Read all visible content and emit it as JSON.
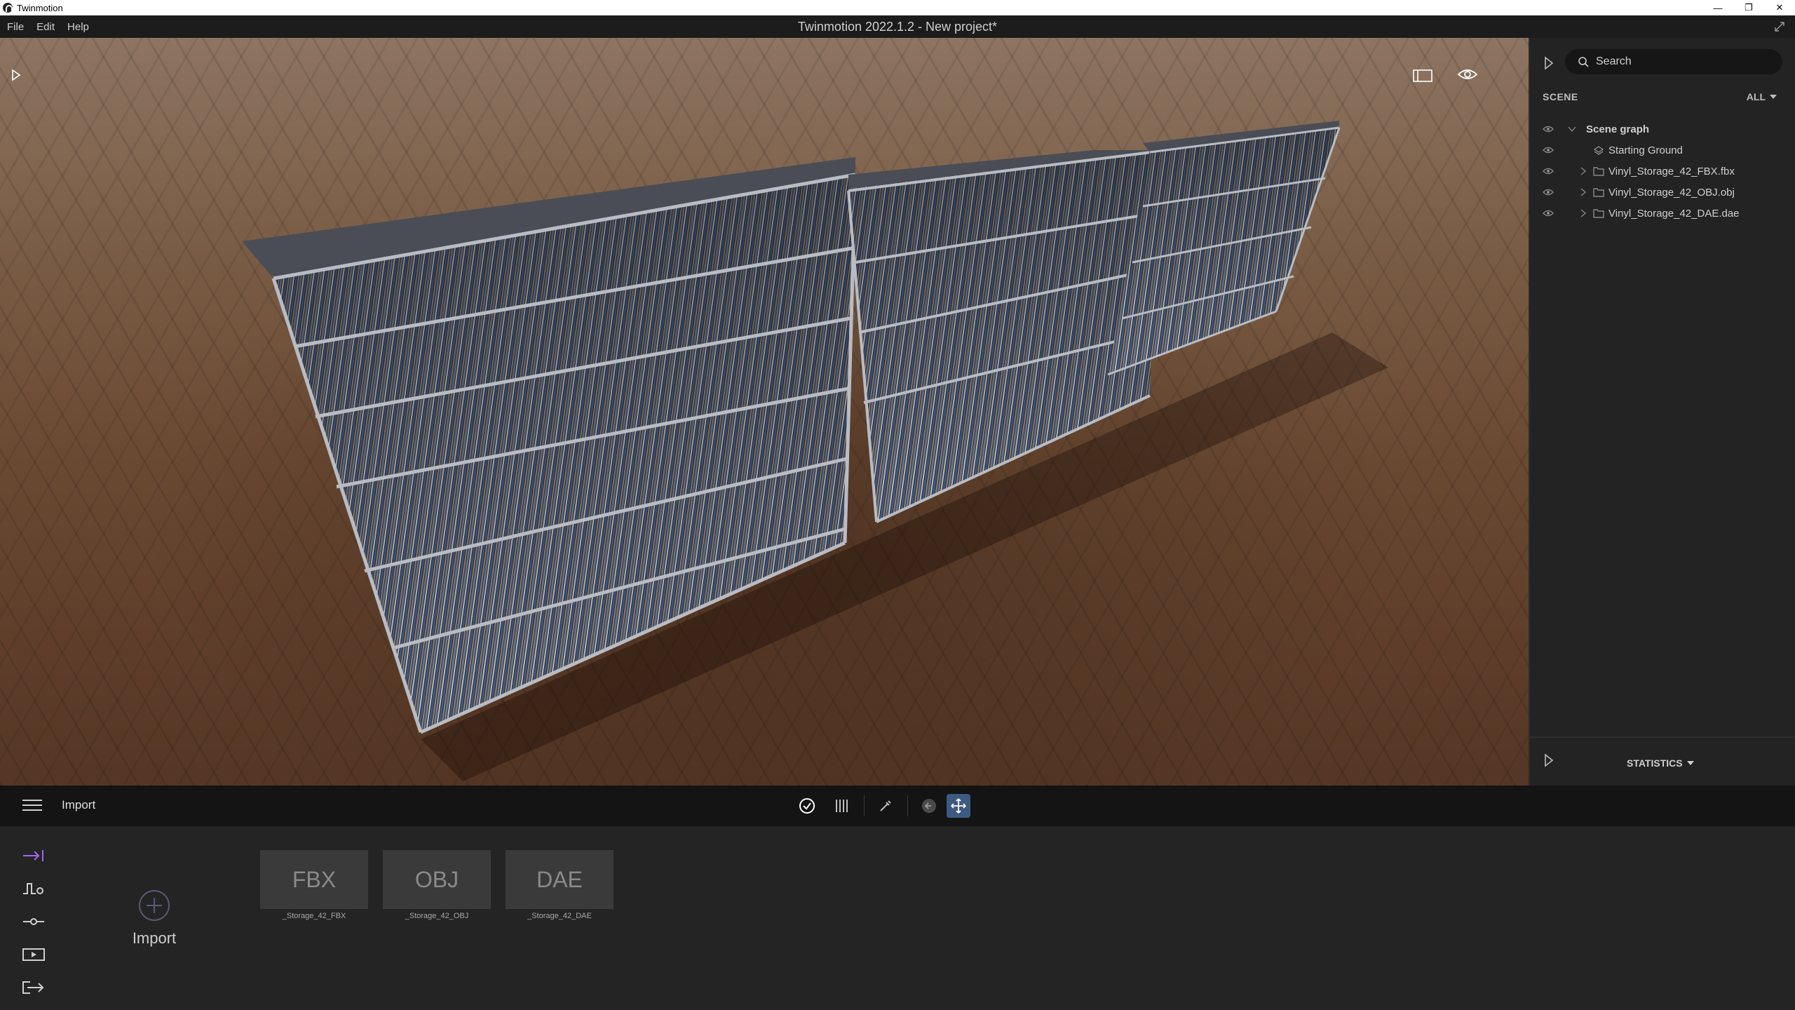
{
  "window": {
    "app_name": "Twinmotion",
    "controls": [
      "—",
      "❐",
      "✕"
    ]
  },
  "menubar": {
    "items": [
      "File",
      "Edit",
      "Help"
    ],
    "title": "Twinmotion 2022.1.2 - New project*"
  },
  "scene_panel": {
    "search_placeholder": "Search",
    "section_label": "SCENE",
    "filter_label": "ALL",
    "tree": [
      {
        "label": "Scene graph",
        "type": "root"
      },
      {
        "label": "Starting Ground",
        "type": "ground"
      },
      {
        "label": "Vinyl_Storage_42_FBX.fbx",
        "type": "folder"
      },
      {
        "label": "Vinyl_Storage_42_OBJ.obj",
        "type": "folder"
      },
      {
        "label": "Vinyl_Storage_42_DAE.dae",
        "type": "folder"
      }
    ],
    "statistics_label": "STATISTICS"
  },
  "toolbar": {
    "section_title": "Import"
  },
  "import_panel": {
    "add_label": "Import",
    "files": [
      {
        "format": "FBX",
        "name": "_Storage_42_FBX"
      },
      {
        "format": "OBJ",
        "name": "_Storage_42_OBJ"
      },
      {
        "format": "DAE",
        "name": "_Storage_42_DAE"
      }
    ]
  },
  "colors": {
    "accent_purple": "#9b6cf0",
    "active_tool": "#3d5a80",
    "panel_bg": "#232323"
  }
}
